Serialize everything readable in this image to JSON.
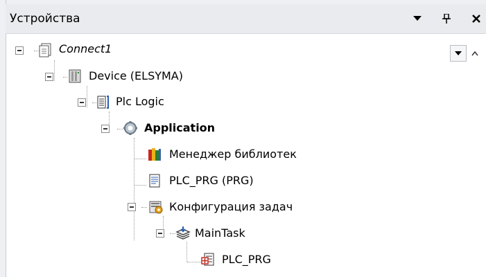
{
  "panel": {
    "title": "Устройства"
  },
  "tree": [
    {
      "label": "Connect1"
    },
    {
      "label": "Device (ELSYMA)"
    },
    {
      "label": "Plc Logic"
    },
    {
      "label": "Application"
    },
    {
      "label": "Менеджер библиотек"
    },
    {
      "label": "PLC_PRG (PRG)"
    },
    {
      "label": "Конфигурация задач"
    },
    {
      "label": "MainTask"
    },
    {
      "label": "PLC_PRG"
    }
  ],
  "icons": {
    "project": "document-icon",
    "device": "plc-device-icon",
    "logic": "plc-logic-icon",
    "app": "gear-icon",
    "lib": "library-books-icon",
    "prg": "program-document-icon",
    "taskcfg": "task-config-icon",
    "task": "task-stack-icon",
    "call": "program-call-icon"
  },
  "colors": {
    "accent": "#7fa4c9"
  }
}
